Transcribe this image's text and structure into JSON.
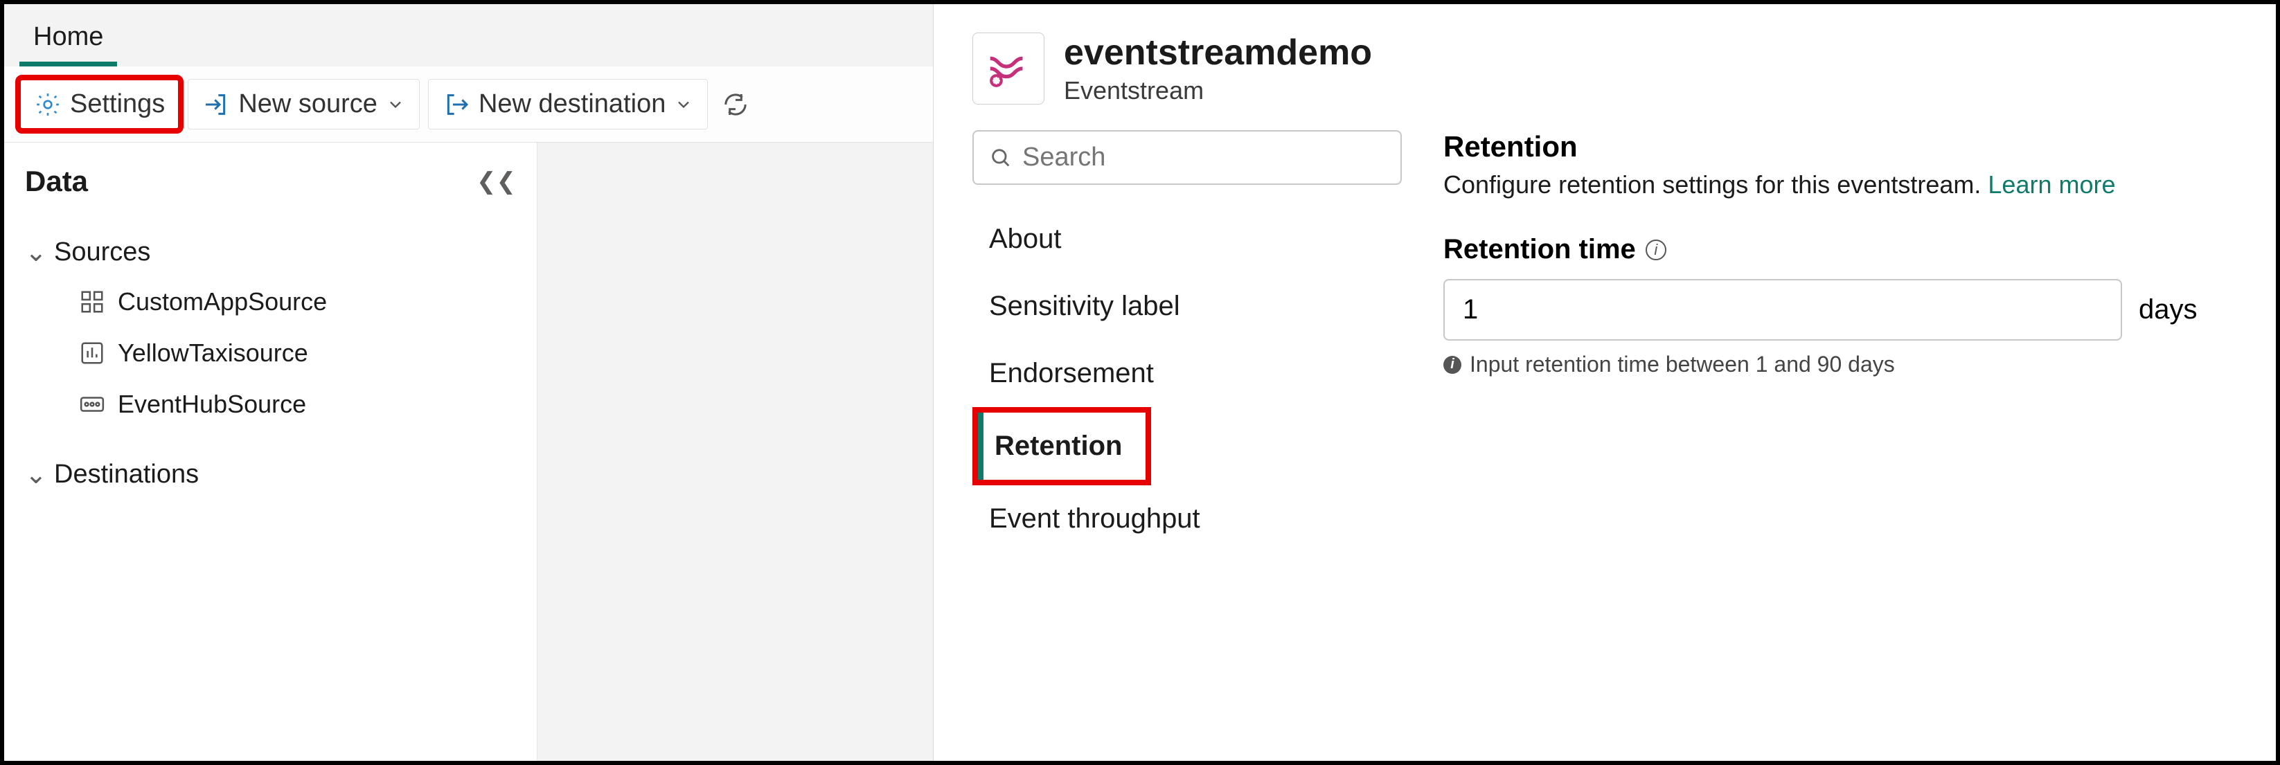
{
  "tabs": {
    "home": "Home"
  },
  "toolbar": {
    "settings": "Settings",
    "new_source": "New source",
    "new_destination": "New destination"
  },
  "sidebar": {
    "title": "Data",
    "groups": {
      "sources": {
        "label": "Sources",
        "items": [
          "CustomAppSource",
          "YellowTaxisource",
          "EventHubSource"
        ]
      },
      "destinations": {
        "label": "Destinations"
      }
    }
  },
  "panel": {
    "title": "eventstreamdemo",
    "subtitle": "Eventstream",
    "search_placeholder": "Search",
    "nav": {
      "about": "About",
      "sensitivity": "Sensitivity label",
      "endorsement": "Endorsement",
      "retention": "Retention",
      "throughput": "Event throughput"
    },
    "retention": {
      "heading": "Retention",
      "desc_prefix": "Configure retention settings for this eventstream. ",
      "learn_more": "Learn more",
      "field_label": "Retention time",
      "value": "1",
      "suffix": "days",
      "hint": "Input retention time between 1 and 90 days"
    }
  }
}
